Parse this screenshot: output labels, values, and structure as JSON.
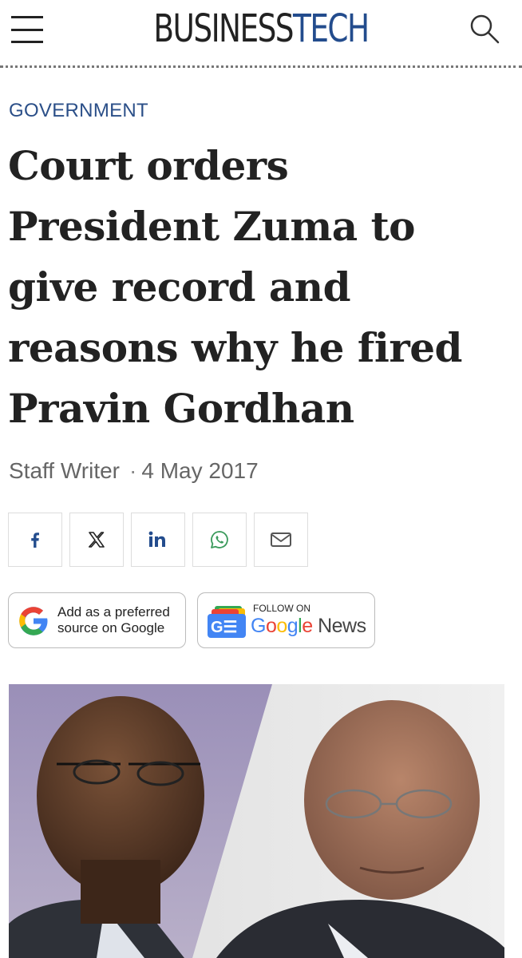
{
  "header": {
    "logo_part1": "BUSINESS",
    "logo_part2": "TECH",
    "menu_icon": "hamburger-menu-icon",
    "search_icon": "search-icon",
    "brand_color": "#234c8d"
  },
  "article": {
    "category": "GOVERNMENT",
    "headline": "Court orders President Zuma to give record and reasons why he fired Pravin Gordhan",
    "author": "Staff Writer",
    "separator": "·",
    "date": "4 May 2017"
  },
  "share": {
    "buttons": [
      {
        "icon": "facebook-icon"
      },
      {
        "icon": "x-icon"
      },
      {
        "icon": "linkedin-icon"
      },
      {
        "icon": "whatsapp-icon"
      },
      {
        "icon": "email-icon"
      }
    ]
  },
  "badges": {
    "google_preferred_line1": "Add as a preferred",
    "google_preferred_line2": "source on Google",
    "google_news_follow": "FOLLOW ON",
    "google_news_name": "Google",
    "google_news_suffix": "News",
    "google_news_icon_text": "G☰"
  },
  "hero_image": {
    "description_icon": "article-photo"
  }
}
